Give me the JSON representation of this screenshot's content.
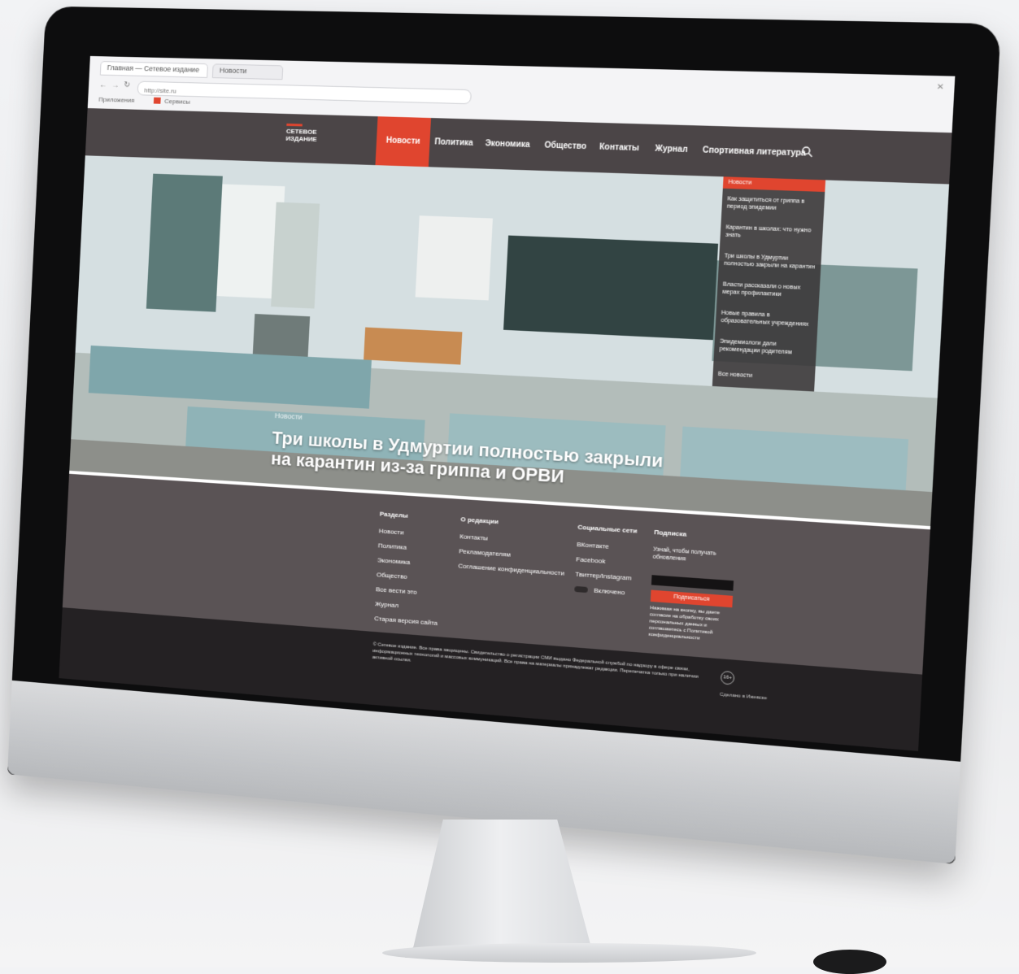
{
  "browser": {
    "tabs": [
      "Главная — Сетевое издание",
      "Новости"
    ],
    "address": "http://site.ru",
    "bookmarks": [
      "Приложения",
      "Сервисы"
    ]
  },
  "site": {
    "logo": [
      "СЕТЕВОЕ",
      "ИЗДАНИЕ"
    ],
    "nav": [
      "Новости",
      "Политика",
      "Экономика",
      "Общество",
      "Контакты",
      "Журнал",
      "Спортивная литература"
    ],
    "active_nav": "Новости"
  },
  "hero": {
    "kicker": "Новости",
    "title": "Три школы в Удмуртии полностью закрыли на карантин из-за гриппа и ОРВИ"
  },
  "dropdown": {
    "header": "Новости",
    "items": [
      "Как защититься от гриппа в период эпидемии",
      "Карантин в школах: что нужно знать",
      "Три школы в Удмуртии полностью закрыли на карантин",
      "Власти рассказали о новых мерах профилактики",
      "Новые правила в образовательных учреждениях",
      "Эпидемиологи дали рекомендации родителям"
    ],
    "all_link": "Все новости"
  },
  "footer": {
    "col1": {
      "heading": "Разделы",
      "links": [
        "Новости",
        "Политика",
        "Экономика",
        "Общество",
        "Все вести это",
        "Журнал",
        "Старая версия сайта"
      ]
    },
    "col2": {
      "heading": "О редакции",
      "links": [
        "Контакты",
        "Рекламодателям",
        "Соглашение конфиденциальности"
      ]
    },
    "col3": {
      "heading": "Социальные сети",
      "links": [
        "ВКонтакте",
        "Facebook",
        "Твиттер/Instagram"
      ],
      "toggle_label": "Включено"
    },
    "col4": {
      "heading": "Подписка",
      "text": "Узнай, чтобы получать обновления",
      "button": "Подписаться",
      "note": "Нажимая на кнопку, вы даете согласие на обработку своих персональных данных и соглашаетесь с Политикой конфиденциальности"
    }
  },
  "bottom": {
    "legal": "© Сетевое издание. Все права защищены. Свидетельство о регистрации СМИ выдано Федеральной службой по надзору в сфере связи, информационных технологий и массовых коммуникаций. Все права на материалы принадлежат редакции. Перепечатка только при наличии активной ссылки.",
    "age": "16+",
    "made": "Сделано в Ижевске"
  },
  "colors": {
    "accent": "#e0452f",
    "header_bg": "#4b4547",
    "footer_bg": "#5a5355",
    "bottom_bg": "#242123"
  },
  "icons": [
    "search-icon",
    "close-icon",
    "back-icon",
    "forward-icon",
    "reload-icon"
  ]
}
